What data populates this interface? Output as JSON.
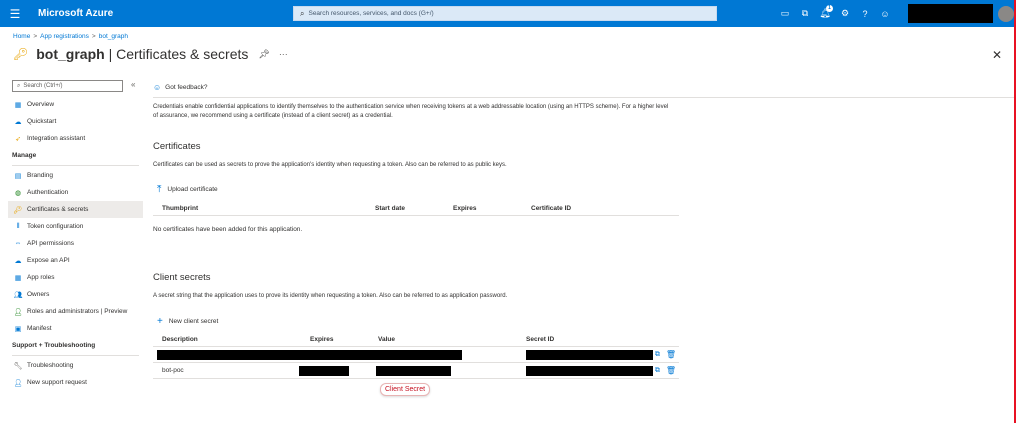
{
  "topbar": {
    "menu_icon": "hamburger-icon",
    "brand": "Microsoft Azure",
    "search_placeholder": "Search resources, services, and docs (G+/)",
    "notification_count": "1"
  },
  "breadcrumb": [
    "Home",
    "App registrations",
    "bot_graph"
  ],
  "header": {
    "app_name": "bot_graph",
    "separator": " | ",
    "page_title": "Certificates & secrets"
  },
  "sidebar": {
    "search_placeholder": "Search (Ctrl+/)",
    "collapse_glyph": "«",
    "top_items": [
      {
        "label": "Overview"
      },
      {
        "label": "Quickstart"
      },
      {
        "label": "Integration assistant"
      }
    ],
    "manage_heading": "Manage",
    "manage_items": [
      {
        "label": "Branding"
      },
      {
        "label": "Authentication"
      },
      {
        "label": "Certificates & secrets"
      },
      {
        "label": "Token configuration"
      },
      {
        "label": "API permissions"
      },
      {
        "label": "Expose an API"
      },
      {
        "label": "App roles"
      },
      {
        "label": "Owners"
      },
      {
        "label": "Roles and administrators | Preview"
      },
      {
        "label": "Manifest"
      }
    ],
    "support_heading": "Support + Troubleshooting",
    "support_items": [
      {
        "label": "Troubleshooting"
      },
      {
        "label": "New support request"
      }
    ]
  },
  "main": {
    "feedback": "Got feedback?",
    "intro": "Credentials enable confidential applications to identify themselves to the authentication service when receiving tokens at a web addressable location (using an HTTPS scheme). For a higher level of assurance, we recommend using a certificate (instead of a client secret) as a credential.",
    "certificates": {
      "title": "Certificates",
      "description": "Certificates can be used as secrets to prove the application's identity when requesting a token. Also can be referred to as public keys.",
      "upload_label": "Upload certificate",
      "columns": [
        "Thumbprint",
        "Start date",
        "Expires",
        "Certificate ID"
      ],
      "empty_message": "No certificates have been added for this application."
    },
    "client_secrets": {
      "title": "Client secrets",
      "description": "A secret string that the application uses to prove its identity when requesting a token. Also can be referred to as application password.",
      "new_label": "New client secret",
      "columns": [
        "Description",
        "Expires",
        "Value",
        "Secret ID"
      ],
      "rows": [
        {
          "description": ""
        },
        {
          "description": "bot-poc"
        }
      ]
    },
    "callout": "Client Secret"
  },
  "colors": {
    "azure_blue": "#0078d4",
    "redaction": "#000000",
    "callout_red": "#c50f1f"
  }
}
